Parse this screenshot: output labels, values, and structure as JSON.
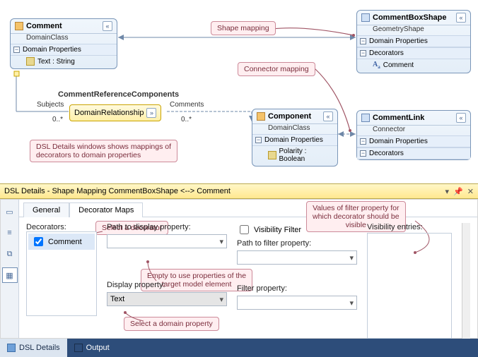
{
  "nodes": {
    "comment": {
      "title": "Comment",
      "subtitle": "DomainClass",
      "section": "Domain Properties",
      "prop": "Text : String"
    },
    "commentBoxShape": {
      "title": "CommentBoxShape",
      "subtitle": "GeometryShape",
      "section1": "Domain Properties",
      "section2": "Decorators",
      "dec": "Comment"
    },
    "component": {
      "title": "Component",
      "subtitle": "DomainClass",
      "section": "Domain Properties",
      "prop": "Polarity : Boolean"
    },
    "commentLink": {
      "title": "CommentLink",
      "subtitle": "Connector",
      "section1": "Domain Properties",
      "section2": "Decorators"
    }
  },
  "relationship": {
    "heading": "CommentReferenceComponents",
    "label": "DomainRelationship",
    "leftRole": "Subjects",
    "leftMult": "0..*",
    "rightRole": "Comments",
    "rightMult": "0..*"
  },
  "callouts": {
    "shapeMapping": "Shape mapping",
    "connectorMapping": "Connector mapping",
    "dslWindows": "DSL Details windows shows mappings of\ndecorators to domain properties",
    "selectDecorator": "Select a decorator",
    "emptyPath": "Empty to use properties of the\ntarget model element",
    "selectDomainProp": "Select a domain property",
    "filterVals": "Values of filter property for\nwhich decorator should be\nvisible"
  },
  "details": {
    "title": "DSL Details - Shape Mapping CommentBoxShape <--> Comment",
    "tabs": {
      "general": "General",
      "decoratorMaps": "Decorator Maps"
    },
    "labels": {
      "decorators": "Decorators:",
      "pathToDisplay": "Path to display property:",
      "displayProperty": "Display property:",
      "visibilityFilter": "Visibility Filter",
      "pathToFilter": "Path to filter property:",
      "filterProperty": "Filter property:",
      "visibilityEntries": "Visibility entries:"
    },
    "decoratorItem": "Comment",
    "displayPropValue": "Text"
  },
  "bottomTabs": {
    "dslDetails": "DSL Details",
    "output": "Output"
  }
}
